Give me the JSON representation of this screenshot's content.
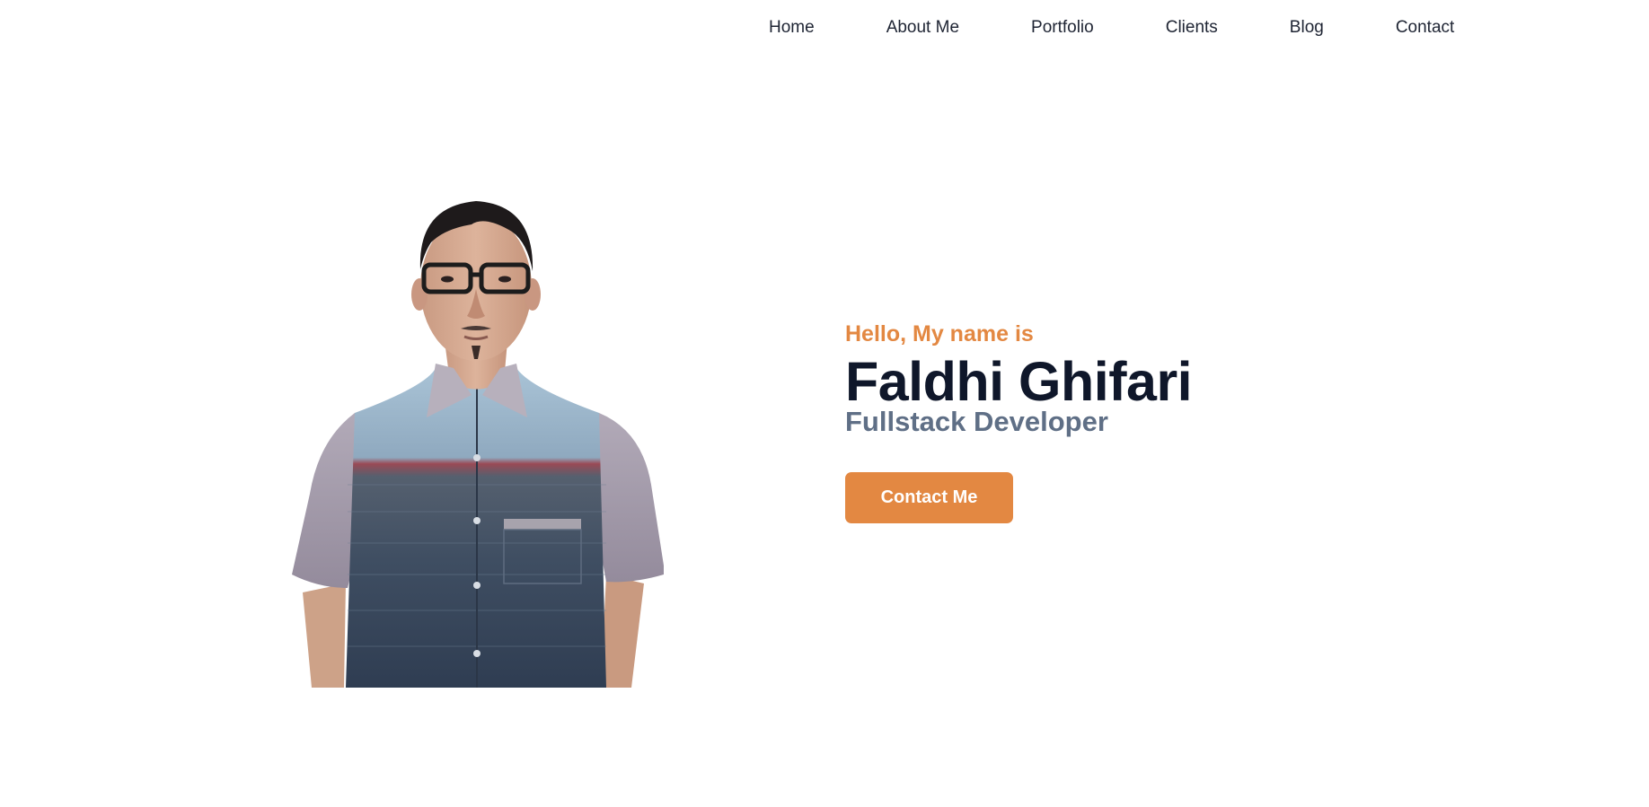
{
  "nav": {
    "items": [
      {
        "label": "Home"
      },
      {
        "label": "About Me"
      },
      {
        "label": "Portfolio"
      },
      {
        "label": "Clients"
      },
      {
        "label": "Blog"
      },
      {
        "label": "Contact"
      }
    ]
  },
  "hero": {
    "greeting": "Hello, My name is",
    "name": "Faldhi Ghifari",
    "role": "Fullstack Developer",
    "cta_label": "Contact Me"
  },
  "colors": {
    "accent": "#e38842",
    "heading": "#0f172a",
    "subheading": "#5f6f86",
    "nav_text": "#1e2433",
    "background": "#ffffff"
  },
  "portrait": {
    "subject": "man with glasses in striped short-sleeve shirt"
  }
}
